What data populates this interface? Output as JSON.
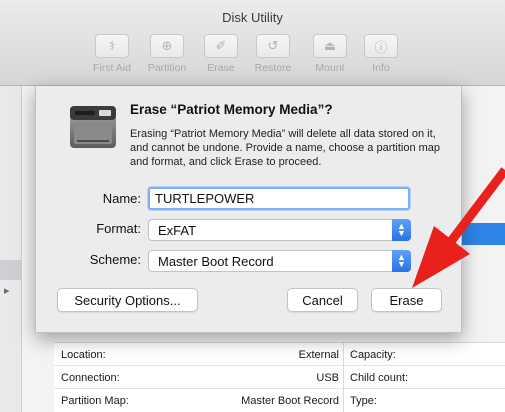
{
  "window": {
    "title": "Disk Utility"
  },
  "toolbar": {
    "buttons": [
      {
        "label": "First Aid",
        "icon": "stethoscope-icon"
      },
      {
        "label": "Partition",
        "icon": "partition-icon"
      },
      {
        "label": "Erase",
        "icon": "erase-icon"
      },
      {
        "label": "Restore",
        "icon": "restore-icon"
      },
      {
        "label": "Mount",
        "icon": "mount-icon"
      },
      {
        "label": "Info",
        "icon": "info-icon"
      }
    ]
  },
  "dialog": {
    "title": "Erase “Patriot Memory Media”?",
    "message": "Erasing “Patriot Memory Media” will delete all data stored on it, and cannot be undone. Provide a name, choose a partition map and format, and click Erase to proceed.",
    "name_label": "Name:",
    "name_value": "TURTLEPOWER",
    "format_label": "Format:",
    "format_value": "ExFAT",
    "scheme_label": "Scheme:",
    "scheme_value": "Master Boot Record",
    "security_button": "Security Options...",
    "cancel_button": "Cancel",
    "erase_button": "Erase"
  },
  "info_table": {
    "rows": [
      {
        "left_label": "Location:",
        "left_value": "External",
        "right_label": "Capacity:"
      },
      {
        "left_label": "Connection:",
        "left_value": "USB",
        "right_label": "Child count:"
      },
      {
        "left_label": "Partition Map:",
        "left_value": "Master Boot Record",
        "right_label": "Type:"
      }
    ]
  },
  "colors": {
    "accent": "#2f84e8",
    "arrow": "#e8211d"
  }
}
